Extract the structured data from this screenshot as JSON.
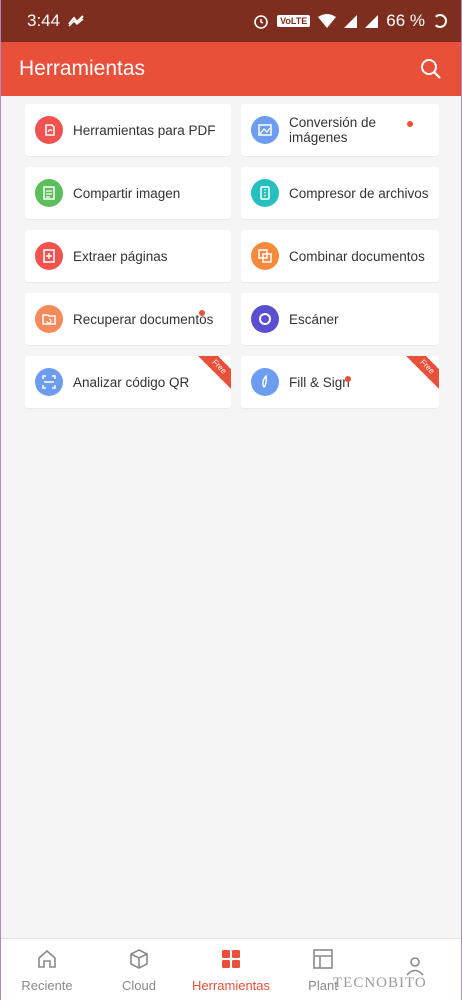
{
  "status": {
    "time": "3:44",
    "volte": "VoLTE",
    "battery": "66 %"
  },
  "appbar": {
    "title": "Herramientas"
  },
  "tools": [
    {
      "label": "Herramientas para PDF",
      "color": "#ef5350",
      "icon": "pdf-tools-icon",
      "dot": false,
      "free": false
    },
    {
      "label": "Conversión de imágenes",
      "color": "#6d9cf0",
      "icon": "image-convert-icon",
      "dot": true,
      "free": false
    },
    {
      "label": "Compartir imagen",
      "color": "#5cbf5c",
      "icon": "share-image-icon",
      "dot": false,
      "free": false
    },
    {
      "label": "Compresor de archivos",
      "color": "#26bfbf",
      "icon": "file-compress-icon",
      "dot": false,
      "free": false
    },
    {
      "label": "Extraer páginas",
      "color": "#ef5350",
      "icon": "extract-pages-icon",
      "dot": false,
      "free": false
    },
    {
      "label": "Combinar documentos",
      "color": "#f58a3d",
      "icon": "merge-docs-icon",
      "dot": false,
      "free": false
    },
    {
      "label": "Recuperar documentos",
      "color": "#f58a5a",
      "icon": "recover-docs-icon",
      "dot": true,
      "free": false
    },
    {
      "label": "Escáner",
      "color": "#5a4fcf",
      "icon": "scanner-icon",
      "dot": false,
      "free": false
    },
    {
      "label": "Analizar código QR",
      "color": "#6d9cf0",
      "icon": "qr-scan-icon",
      "dot": false,
      "free": true
    },
    {
      "label": "Fill & Sign",
      "color": "#6d9cf0",
      "icon": "fill-sign-icon",
      "dot": true,
      "free": true
    }
  ],
  "free_badge": "Free",
  "nav": [
    {
      "label": "Reciente",
      "icon": "home-icon",
      "active": false
    },
    {
      "label": "Cloud",
      "icon": "cloud-box-icon",
      "active": false
    },
    {
      "label": "Herramientas",
      "icon": "tools-grid-icon",
      "active": true
    },
    {
      "label": "Plant",
      "icon": "templates-icon",
      "active": false
    },
    {
      "label": "",
      "icon": "profile-icon",
      "active": false
    }
  ],
  "watermark": "TECNOBITO"
}
